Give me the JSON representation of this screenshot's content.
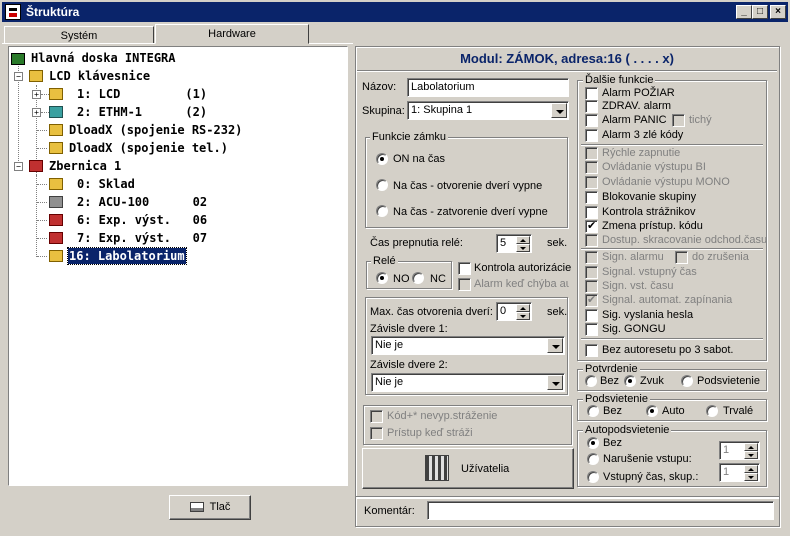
{
  "window": {
    "title": "Štruktúra"
  },
  "tabs": [
    {
      "label": "Systém"
    },
    {
      "label": "Hardware"
    }
  ],
  "tree": {
    "root": "Hlavná doska INTEGRA",
    "lcd": "LCD klávesnice",
    "lcd1": "1: LCD         (1)",
    "ethm": "2: ETHM-1      (2)",
    "dload1": "DloadX (spojenie RS-232)",
    "dload2": "DloadX (spojenie tel.)",
    "zbernica": "Zbernica 1",
    "sklad": "0: Sklad",
    "acu": "2: ACU-100      02",
    "exp6": "6: Exp. výst.   06",
    "exp7": "7: Exp. výst.   07",
    "lab": "16: Labolatorium"
  },
  "print_button": "Tlač",
  "module_header": "Modul: ZÁMOK, adresa:16 ( . . . . x)",
  "nazov": {
    "label": "Názov:",
    "value": "Labolatorium"
  },
  "skupina": {
    "label": "Skupina:",
    "value": "1: Skupina  1"
  },
  "funkcie": {
    "title": "Funkcie zámku",
    "opt1": "ON na čas",
    "opt2": "Na čas - otvorenie dverí vypne",
    "opt3": "Na čas - zatvorenie dverí vypne"
  },
  "cas_prepnutia": {
    "label": "Čas prepnutia relé:",
    "value": "5",
    "unit": "sek."
  },
  "rele": {
    "title": "Relé",
    "no": "NO",
    "nc": "NC"
  },
  "kontrola_aut": "Kontrola autorizácie",
  "alarm_chyba": "Alarm keď chýba au",
  "max_cas": {
    "label": "Max. čas otvorenia dverí:",
    "value": "0",
    "unit": "sek."
  },
  "zavisle1": {
    "label": "Závisle dvere 1:",
    "value": "Nie je"
  },
  "zavisle2": {
    "label": "Závisle dvere 2:",
    "value": "Nie je"
  },
  "kod_nevyp": "Kód+* nevyp.stráženie",
  "pristup_strazi": "Prístup keď stráži",
  "uzivatelia_button": "Užívatelia",
  "dalsie": {
    "title": "Ďalšie funkcie",
    "items": [
      "Alarm POŽIAR",
      "ZDRAV. alarm",
      "Alarm PANIC",
      "tichý",
      "Alarm 3 zlé kódy",
      "Rýchle zapnutie",
      "Ovládanie výstupu BI",
      "Ovládanie výstupu MONO",
      "Blokovanie skupiny",
      "Kontrola strážnikov",
      "Zmena prístup. kódu",
      "Dostup. skracovanie odchod.času",
      "Sign. alarmu",
      "do zrušenia",
      "Signal. vstupný čas",
      "Sign. vst. času",
      "Signal. automat. zapínania",
      "Sig. vyslania hesla",
      "Sig. GONGU",
      "Bez autoresetu po 3 sabot."
    ]
  },
  "potvrdenie": {
    "title": "Potvrdenie",
    "bez": "Bez",
    "zvuk": "Zvuk",
    "podsvietenie": "Podsvietenie"
  },
  "podsvietenie": {
    "title": "Podsvietenie",
    "bez": "Bez",
    "auto": "Auto",
    "trvale": "Trvalé"
  },
  "autopodsvietenie": {
    "title": "Autopodsvietenie",
    "bez": "Bez",
    "narusenie": "Narušenie vstupu:",
    "vstupny": "Vstupný čas, skup.:",
    "v1": "1",
    "v2": "1"
  },
  "komentar": {
    "label": "Komentár:",
    "value": ""
  }
}
